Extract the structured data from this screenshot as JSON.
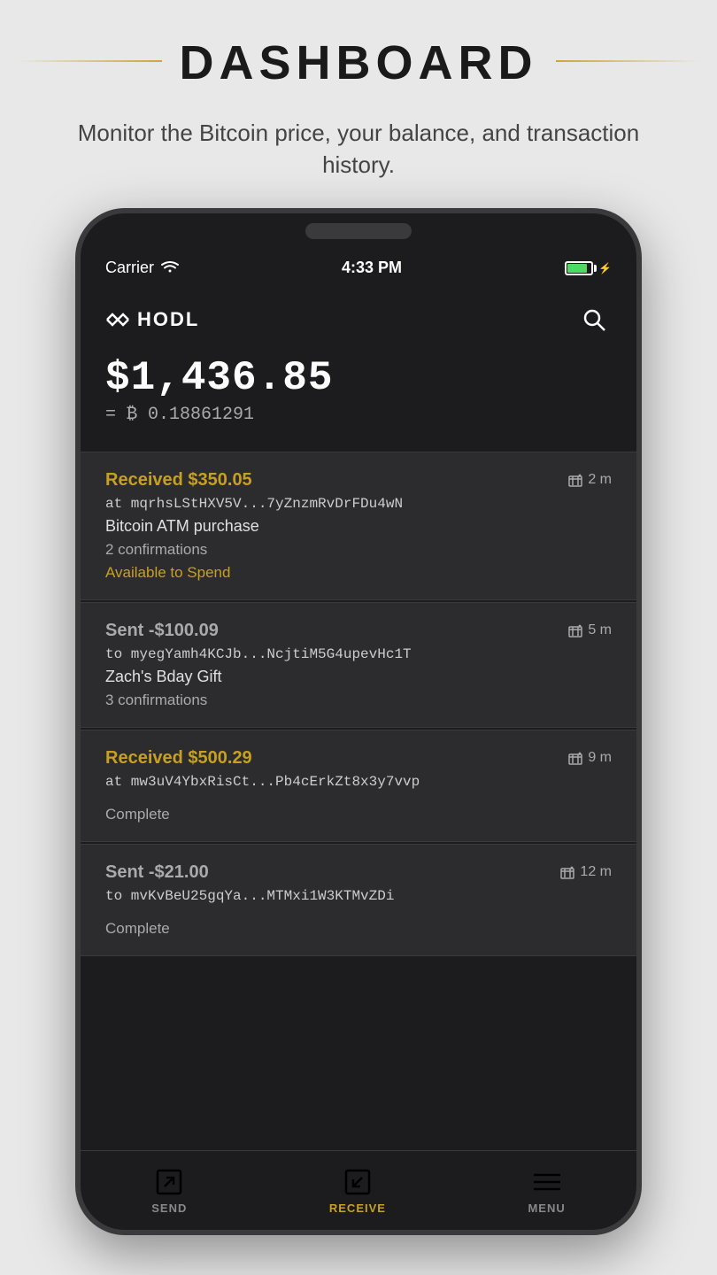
{
  "page": {
    "title": "DASHBOARD",
    "subtitle": "Monitor the Bitcoin price, your balance, and transaction history."
  },
  "status_bar": {
    "carrier": "Carrier",
    "time": "4:33 PM"
  },
  "app": {
    "logo": "◇ HODL",
    "balance_usd": "$1,436.85",
    "balance_btc": "= ₿ 0.18861291"
  },
  "transactions": [
    {
      "amount": "Received $350.05",
      "type": "received",
      "time": "2 m",
      "address": "at mqrhsLStHXV5V...7yZnzmRvDrFDu4wN",
      "memo": "Bitcoin ATM purchase",
      "confirmations": "2 confirmations",
      "status": "Available to Spend",
      "status_type": "available"
    },
    {
      "amount": "Sent -$100.09",
      "type": "sent",
      "time": "5 m",
      "address": "to myegYamh4KCJb...NcjtiM5G4upevHc1T",
      "memo": "Zach's Bday Gift",
      "confirmations": "3 confirmations",
      "status": "",
      "status_type": "none"
    },
    {
      "amount": "Received $500.29",
      "type": "received",
      "time": "9 m",
      "address": "at mw3uV4YbxRisCt...Pb4cErkZt8x3y7vvp",
      "memo": "",
      "confirmations": "",
      "status": "Complete",
      "status_type": "complete"
    },
    {
      "amount": "Sent -$21.00",
      "type": "sent",
      "time": "12 m",
      "address": "to mvKvBeU25gqYa...MTMxi1W3KTMvZDi",
      "memo": "",
      "confirmations": "",
      "status": "Complete",
      "status_type": "complete"
    }
  ],
  "nav": {
    "items": [
      {
        "label": "SEND",
        "active": false
      },
      {
        "label": "RECEIVE",
        "active": true
      },
      {
        "label": "MENU",
        "active": false
      }
    ]
  }
}
